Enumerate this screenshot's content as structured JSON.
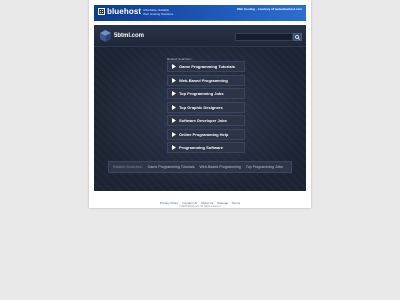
{
  "banner": {
    "brand": "bluehost",
    "tagline_line1": "Affordable, Reliable",
    "tagline_line2": "Web Hosting Solutions",
    "right_text": "Web Hosting - courtesy of www.bluehost.com"
  },
  "header": {
    "site_title": "5btml.com",
    "search_placeholder": ""
  },
  "related": {
    "heading": "Related Searches:",
    "items": [
      {
        "label": "Game Programming Tutorials"
      },
      {
        "label": "Web-Based Programming"
      },
      {
        "label": "Top Programming Jobs"
      },
      {
        "label": "Top Graphic Designers"
      },
      {
        "label": "Software Developer Jobs"
      },
      {
        "label": "Online Programming Help"
      },
      {
        "label": "Programming Software"
      }
    ]
  },
  "bottom_bar": {
    "lead": "Related Searches:",
    "items": [
      {
        "label": "Game Programming Tutorials"
      },
      {
        "label": "Web-Based Programming"
      },
      {
        "label": "Top Programming Jobs"
      }
    ]
  },
  "footer": {
    "links": [
      "Privacy Policy",
      "Contact Us",
      "About Us",
      "Sitemap",
      "Terms"
    ],
    "copyright": "© 2025 5btml.com. All rights reserved."
  },
  "colors": {
    "banner_blue": "#1d57b8",
    "panel_dark": "#1d2535",
    "link_blue": "#3a5fb5"
  },
  "icons": {
    "arrow": "play-arrow-icon",
    "search": "search-icon",
    "site_logo": "cube-icon"
  }
}
